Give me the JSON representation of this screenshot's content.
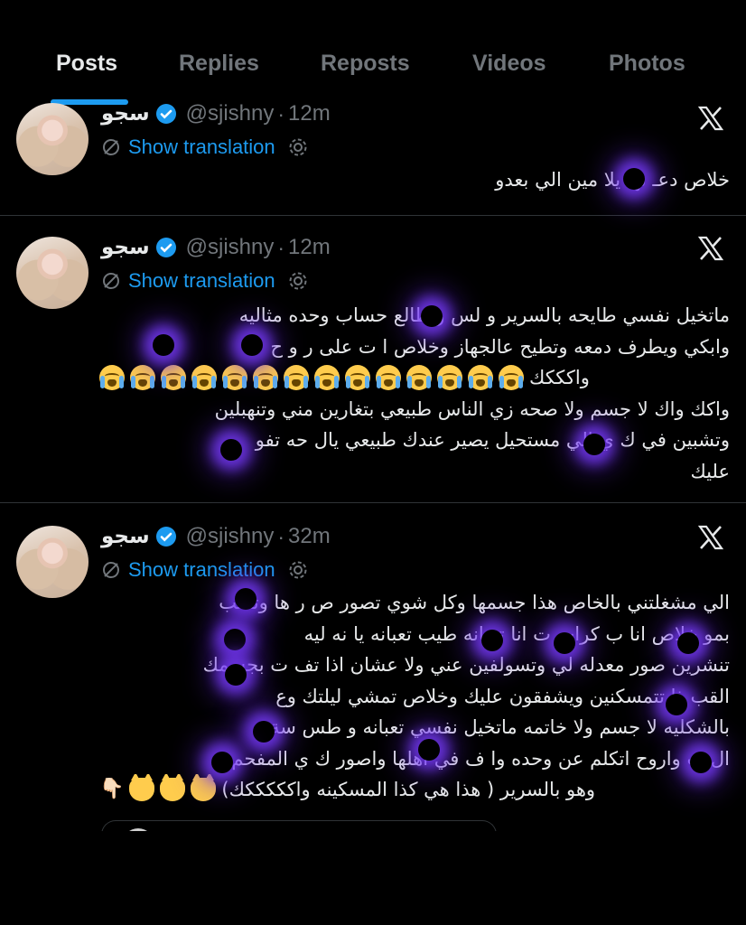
{
  "tabs": [
    {
      "label": "Posts",
      "active": true
    },
    {
      "label": "Replies",
      "active": false
    },
    {
      "label": "Reposts",
      "active": false
    },
    {
      "label": "Videos",
      "active": false
    },
    {
      "label": "Photos",
      "active": false
    }
  ],
  "accent_color": "#1d9bf0",
  "tweets": [
    {
      "name": "سجو",
      "handle": "@sjishny",
      "separator": "·",
      "time": "12m",
      "translate": "Show translation",
      "lines": [
        "خلاص دعـ نها يلا مين الي بعدو"
      ]
    },
    {
      "name": "سجو",
      "handle": "@sjishny",
      "separator": "·",
      "time": "12m",
      "translate": "Show translation",
      "lines": [
        "ماتخيل نفسي طايحه بالسرير و لس واطالع حساب وحده مثاليه",
        "وابكي ويطرف دمعه وتطيح عالجهاز وخلاص ا ت على  ر و ح",
        "واكككك",
        "واكك واك لا جسم ولا صحه زي الناس طبيعي بتغارين مني وتنهبلين",
        "وتشبين في ك  ي الي مستحيل يصير عندك طبيعي يال  حه تفو",
        "عليك"
      ],
      "emoji_count": 14
    },
    {
      "name": "سجو",
      "handle": "@sjishny",
      "separator": "·",
      "time": "32m",
      "translate": "Show translation",
      "lines": [
        "الي مشغلتني بالخاص هذا جسمها وكل شوي تصور ص ر ها وتكتب",
        "بمو  خلاص انا ب  كرات   ت انا تعبانه طيب تعبانه يا  نه ليه",
        "تنشرين صور معدله لي وتسولفين عني ولا عشان اذا تف  ت بجسمك",
        "القب   ذا تتمسكنين ويشفقون عليك وخلاص تمشي ليلتك وع",
        "بالشكليه لا جسم ولا خاتمه ماتخيل نفسي تعبانه و  طس    سة",
        "ال  ب واروح اتكلم عن وحده وا  ف في اهلها واصور ك  ي المفحم",
        "وهو بالسرير ( هذا هي كذا المسكينه واكككككك)"
      ],
      "cat_emoji_count": 3,
      "hand_emoji": "👇🏻"
    }
  ]
}
